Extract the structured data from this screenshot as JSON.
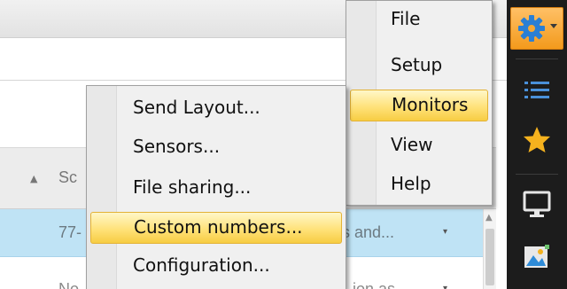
{
  "grid": {
    "sort_icon": "▲",
    "column_header": "Sc",
    "selected_row": {
      "cell1": "77-",
      "cell2": "s and...",
      "dropdown": "▾"
    },
    "row2": {
      "cell1": "No",
      "cell2": "ion as",
      "dropdown": "▾"
    },
    "scroll_up": "▲"
  },
  "menu": {
    "items": [
      "File",
      "Setup",
      "Monitors",
      "View",
      "Help"
    ],
    "active_index": 2
  },
  "submenu": {
    "items": [
      "Send Layout...",
      "Sensors...",
      "File sharing...",
      "Custom numbers...",
      "Configuration..."
    ],
    "active_index": 3
  },
  "sidebar": {
    "icons": [
      "gear-icon",
      "list-icon",
      "star-icon",
      "monitor-icon",
      "image-icon"
    ],
    "accent_color": "#f39a1c",
    "background_color": "#1c1c1c"
  },
  "colors": {
    "menu_highlight": "#ffe27a",
    "selected_row": "#bfe3f5"
  }
}
